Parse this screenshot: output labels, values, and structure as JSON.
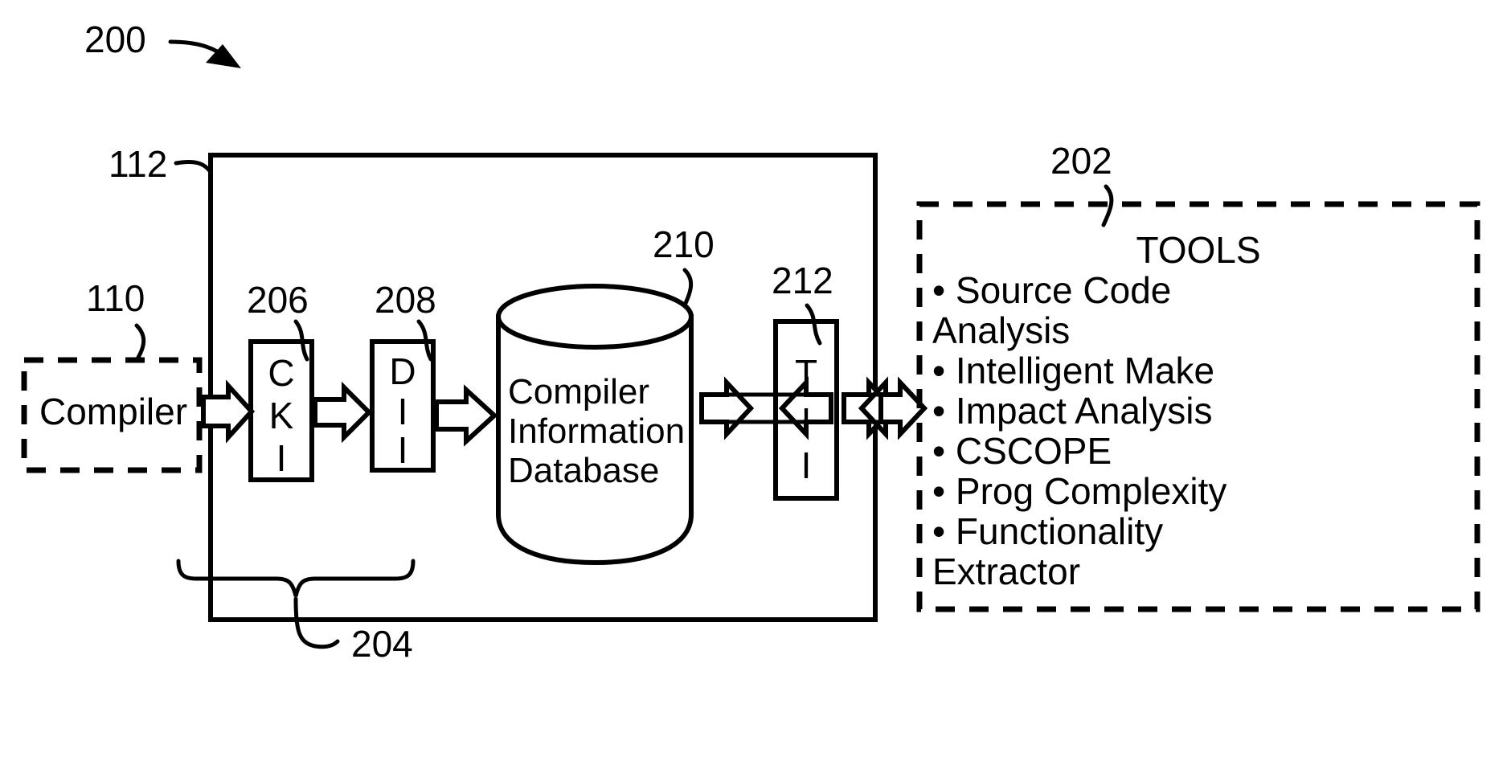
{
  "figure": {
    "number": "200",
    "title_label": "200"
  },
  "reference_numerals": {
    "figure": "200",
    "system_box": "112",
    "compiler": "110",
    "tools": "202",
    "cki_dii_group": "204",
    "cki": "206",
    "dii": "208",
    "database": "210",
    "tii": "212"
  },
  "compiler_block": {
    "label": "Compiler",
    "ref": "110",
    "style": "dashed"
  },
  "system_block": {
    "ref": "112",
    "style": "solid"
  },
  "cki_block": {
    "ref": "206",
    "letters": [
      "C",
      "K",
      "I"
    ],
    "acronym": "CKI"
  },
  "dii_block": {
    "ref": "208",
    "letters": [
      "D",
      "I",
      "I"
    ],
    "acronym": "DII"
  },
  "database_block": {
    "ref": "210",
    "lines": [
      "Compiler",
      "Information",
      "Database"
    ],
    "shape": "cylinder"
  },
  "tii_block": {
    "ref": "212",
    "letters": [
      "T",
      "I",
      "I"
    ],
    "acronym": "TII"
  },
  "group_brace": {
    "ref": "204"
  },
  "tools_block": {
    "ref": "202",
    "heading": "TOOLS",
    "style": "dashed",
    "items": [
      {
        "bullet": "•",
        "line1": "Source Code",
        "line2": "Analysis"
      },
      {
        "bullet": "•",
        "line1": "Intelligent Make",
        "line2": ""
      },
      {
        "bullet": "•",
        "line1": "Impact Analysis",
        "line2": ""
      },
      {
        "bullet": "•",
        "line1": "CSCOPE",
        "line2": ""
      },
      {
        "bullet": "•",
        "line1": "Prog Complexity",
        "line2": ""
      },
      {
        "bullet": "•",
        "line1": "Functionality",
        "line2": "Extractor"
      }
    ],
    "flat_lines": [
      "• Source Code",
      "Analysis",
      "• Intelligent Make",
      "• Impact Analysis",
      "• CSCOPE",
      "• Prog Complexity",
      "• Functionality",
      "Extractor"
    ]
  },
  "connectors": {
    "compiler_to_cki": "outline-arrow-right",
    "cki_to_dii": "outline-arrow-right",
    "dii_to_database": "outline-arrow-right",
    "database_to_tii": "outline-arrow-double",
    "tii_to_tools": "outline-arrow-double"
  },
  "colors": {
    "ink": "#000000",
    "paper": "#ffffff"
  }
}
